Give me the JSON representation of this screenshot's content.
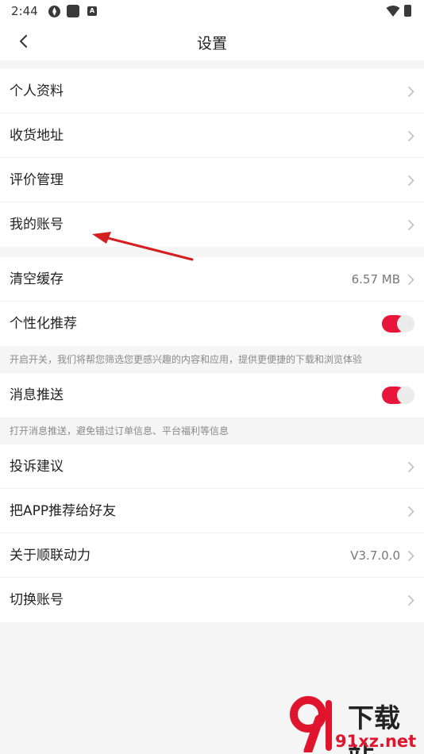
{
  "status_bar": {
    "time": "2:44"
  },
  "nav": {
    "title": "设置",
    "back_icon": "chevron-left-icon"
  },
  "group1": [
    {
      "label": "个人资料"
    },
    {
      "label": "收货地址"
    },
    {
      "label": "评价管理"
    },
    {
      "label": "我的账号"
    }
  ],
  "cache": {
    "label": "清空缓存",
    "value": "6.57 MB"
  },
  "personalized": {
    "label": "个性化推荐",
    "enabled": true,
    "hint": "开启开关，我们将帮您筛选您更感兴趣的内容和应用，提供更便捷的下载和浏览体验"
  },
  "push": {
    "label": "消息推送",
    "enabled": true,
    "hint": "打开消息推送，避免错过订单信息、平台福利等信息"
  },
  "group3": [
    {
      "label": "投诉建议"
    },
    {
      "label": "把APP推荐给好友"
    },
    {
      "label": "关于顺联动力",
      "value": "V3.7.0.0"
    },
    {
      "label": "切换账号"
    }
  ],
  "watermark": {
    "top": "下载站",
    "bottom": "91xz.net"
  },
  "colors": {
    "accent": "#e8163a",
    "background": "#f5f5f5",
    "annotation_arrow": "#d42020"
  }
}
